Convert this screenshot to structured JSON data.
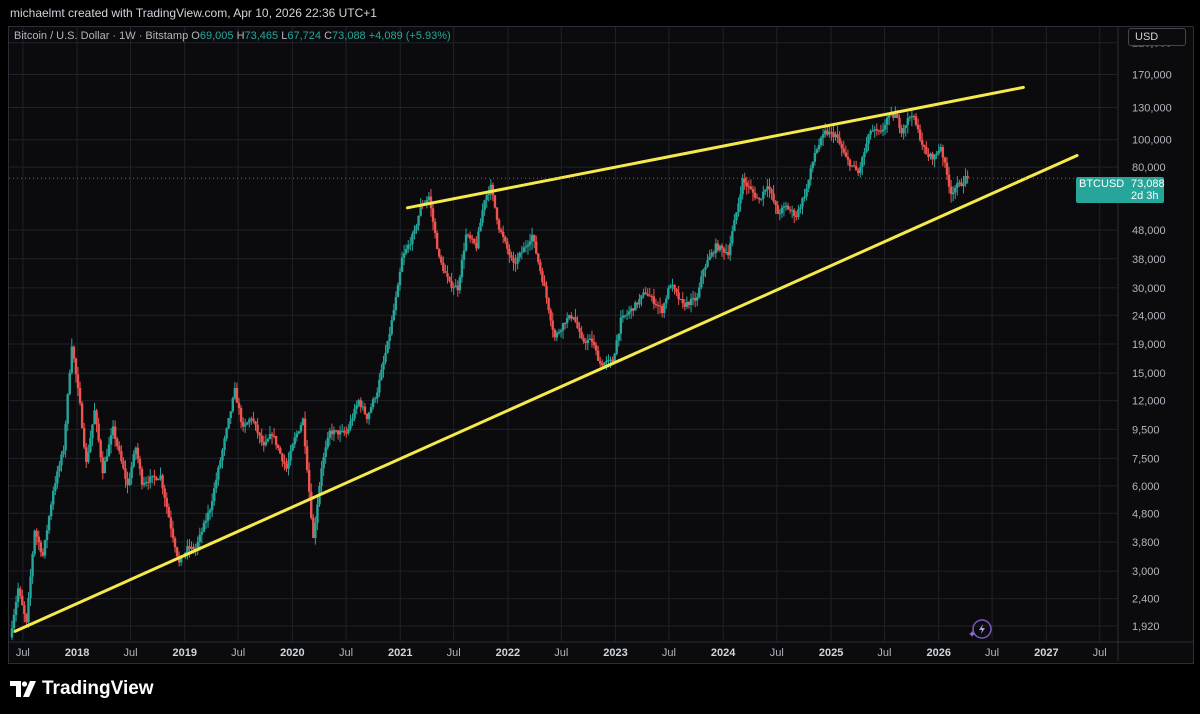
{
  "header": {
    "attribution": "michaelmt created with TradingView.com, Apr 10, 2026 22:36 UTC+1"
  },
  "legend": {
    "instrument": "Bitcoin / U.S. Dollar · 1W · Bitstamp",
    "o_label": "O",
    "o_value": "69,005",
    "h_label": "H",
    "h_value": "73,465",
    "l_label": "L",
    "l_value": "67,724",
    "c_label": "C",
    "c_value": "73,088",
    "change": "+4,089 (+5.93%)"
  },
  "price_scale": {
    "currency": "USD"
  },
  "price_tag": {
    "symbol": "BTCUSD",
    "last_price": "73,088",
    "countdown": "2d 3h"
  },
  "brand": {
    "name": "TradingView"
  },
  "colors": {
    "up": "#26a69a",
    "down": "#ef5350",
    "trendline": "#f5e94c",
    "background": "#0b0b0d",
    "grid": "#1f222a"
  },
  "icons": {
    "logo": "tradingview-logo-icon",
    "assistant": "sparkle-lightning-icon"
  },
  "chart_data": {
    "type": "candlestick",
    "y_scale": "log",
    "ylim": [
      1700,
      250000
    ],
    "xlim": [
      "2017-05-15",
      "2027-09-01"
    ],
    "y_ticks": [
      1920,
      2400,
      3000,
      3800,
      4800,
      6000,
      7500,
      9500,
      12000,
      15000,
      19000,
      24000,
      30000,
      38000,
      48000,
      80000,
      100000,
      130000,
      170000,
      220000
    ],
    "y_tick_labels": [
      "1,920",
      "2,400",
      "3,000",
      "3,800",
      "4,800",
      "6,000",
      "7,500",
      "9,500",
      "12,000",
      "15,000",
      "19,000",
      "24,000",
      "30,000",
      "38,000",
      "48,000",
      "80,000",
      "100,000",
      "130,000",
      "170,000",
      "220,000"
    ],
    "x_ticks": [
      {
        "label": "Jul",
        "date": "2017-07-01",
        "bold": false
      },
      {
        "label": "2018",
        "date": "2018-01-01",
        "bold": true
      },
      {
        "label": "Jul",
        "date": "2018-07-01",
        "bold": false
      },
      {
        "label": "2019",
        "date": "2019-01-01",
        "bold": true
      },
      {
        "label": "Jul",
        "date": "2019-07-01",
        "bold": false
      },
      {
        "label": "2020",
        "date": "2020-01-01",
        "bold": true
      },
      {
        "label": "Jul",
        "date": "2020-07-01",
        "bold": false
      },
      {
        "label": "2021",
        "date": "2021-01-01",
        "bold": true
      },
      {
        "label": "Jul",
        "date": "2021-07-01",
        "bold": false
      },
      {
        "label": "2022",
        "date": "2022-01-01",
        "bold": true
      },
      {
        "label": "Jul",
        "date": "2022-07-01",
        "bold": false
      },
      {
        "label": "2023",
        "date": "2023-01-01",
        "bold": true
      },
      {
        "label": "Jul",
        "date": "2023-07-01",
        "bold": false
      },
      {
        "label": "2024",
        "date": "2024-01-01",
        "bold": true
      },
      {
        "label": "Jul",
        "date": "2024-07-01",
        "bold": false
      },
      {
        "label": "2025",
        "date": "2025-01-01",
        "bold": true
      },
      {
        "label": "Jul",
        "date": "2025-07-01",
        "bold": false
      },
      {
        "label": "2026",
        "date": "2026-01-01",
        "bold": true
      },
      {
        "label": "Jul",
        "date": "2026-07-01",
        "bold": false
      },
      {
        "label": "2027",
        "date": "2027-01-01",
        "bold": true
      },
      {
        "label": "Jul",
        "date": "2027-07-01",
        "bold": false
      }
    ],
    "price_path": [
      [
        "2017-05-22",
        1750
      ],
      [
        "2017-06-19",
        2600
      ],
      [
        "2017-07-17",
        1950
      ],
      [
        "2017-08-14",
        4200
      ],
      [
        "2017-09-11",
        3400
      ],
      [
        "2017-10-16",
        5800
      ],
      [
        "2017-11-20",
        8100
      ],
      [
        "2017-12-18",
        19000
      ],
      [
        "2018-01-15",
        11500
      ],
      [
        "2018-02-05",
        7200
      ],
      [
        "2018-03-05",
        11000
      ],
      [
        "2018-04-02",
        6800
      ],
      [
        "2018-05-07",
        9500
      ],
      [
        "2018-06-25",
        6000
      ],
      [
        "2018-07-23",
        8200
      ],
      [
        "2018-08-13",
        6200
      ],
      [
        "2018-10-15",
        6500
      ],
      [
        "2018-11-19",
        4300
      ],
      [
        "2018-12-17",
        3200
      ],
      [
        "2019-01-14",
        3600
      ],
      [
        "2019-02-11",
        3600
      ],
      [
        "2019-04-01",
        5000
      ],
      [
        "2019-05-13",
        8000
      ],
      [
        "2019-06-24",
        13000
      ],
      [
        "2019-07-22",
        9500
      ],
      [
        "2019-08-19",
        10500
      ],
      [
        "2019-09-30",
        8200
      ],
      [
        "2019-10-28",
        9200
      ],
      [
        "2019-12-16",
        6900
      ],
      [
        "2020-01-13",
        8800
      ],
      [
        "2020-02-10",
        10300
      ],
      [
        "2020-03-16",
        3900
      ],
      [
        "2020-04-13",
        7000
      ],
      [
        "2020-05-11",
        9300
      ],
      [
        "2020-07-06",
        9200
      ],
      [
        "2020-08-17",
        12000
      ],
      [
        "2020-09-14",
        10500
      ],
      [
        "2020-10-19",
        13000
      ],
      [
        "2020-11-23",
        19000
      ],
      [
        "2020-12-28",
        30000
      ],
      [
        "2021-01-11",
        38000
      ],
      [
        "2021-02-22",
        47000
      ],
      [
        "2021-03-15",
        58000
      ],
      [
        "2021-04-12",
        63000
      ],
      [
        "2021-05-17",
        38000
      ],
      [
        "2021-06-21",
        31000
      ],
      [
        "2021-07-19",
        30000
      ],
      [
        "2021-08-16",
        46000
      ],
      [
        "2021-09-20",
        42000
      ],
      [
        "2021-10-18",
        62000
      ],
      [
        "2021-11-08",
        68000
      ],
      [
        "2021-12-06",
        49000
      ],
      [
        "2022-01-24",
        36000
      ],
      [
        "2022-03-28",
        46000
      ],
      [
        "2022-05-09",
        30000
      ],
      [
        "2022-06-13",
        20000
      ],
      [
        "2022-07-18",
        23000
      ],
      [
        "2022-08-15",
        24000
      ],
      [
        "2022-09-12",
        19500
      ],
      [
        "2022-10-17",
        19500
      ],
      [
        "2022-11-14",
        16200
      ],
      [
        "2022-12-26",
        16500
      ],
      [
        "2023-01-23",
        23000
      ],
      [
        "2023-03-13",
        26000
      ],
      [
        "2023-04-17",
        29000
      ],
      [
        "2023-06-12",
        25000
      ],
      [
        "2023-07-10",
        31000
      ],
      [
        "2023-08-21",
        26000
      ],
      [
        "2023-10-09",
        27500
      ],
      [
        "2023-10-30",
        35000
      ],
      [
        "2023-12-11",
        42000
      ],
      [
        "2024-01-22",
        40000
      ],
      [
        "2024-02-26",
        60000
      ],
      [
        "2024-03-11",
        72000
      ],
      [
        "2024-05-06",
        61000
      ],
      [
        "2024-06-03",
        70000
      ],
      [
        "2024-07-08",
        55000
      ],
      [
        "2024-08-05",
        58000
      ],
      [
        "2024-09-09",
        54000
      ],
      [
        "2024-10-14",
        67000
      ],
      [
        "2024-11-11",
        90000
      ],
      [
        "2024-12-16",
        106000
      ],
      [
        "2025-01-20",
        104000
      ],
      [
        "2025-02-24",
        86000
      ],
      [
        "2025-04-07",
        76000
      ],
      [
        "2025-05-19",
        108000
      ],
      [
        "2025-06-23",
        105000
      ],
      [
        "2025-07-14",
        119000
      ],
      [
        "2025-08-11",
        122000
      ],
      [
        "2025-09-01",
        108000
      ],
      [
        "2025-10-06",
        124000
      ],
      [
        "2025-11-03",
        102000
      ],
      [
        "2025-11-24",
        88000
      ],
      [
        "2025-12-22",
        87000
      ],
      [
        "2026-01-12",
        95000
      ],
      [
        "2026-02-02",
        75000
      ],
      [
        "2026-02-16",
        65000
      ],
      [
        "2026-03-02",
        68000
      ],
      [
        "2026-03-23",
        70000
      ],
      [
        "2026-04-06",
        73088
      ]
    ],
    "trendlines": [
      {
        "name": "upper",
        "from": [
          "2021-01-25",
          57500
        ],
        "to": [
          "2026-10-15",
          153000
        ]
      },
      {
        "name": "lower",
        "from": [
          "2017-06-05",
          1840
        ],
        "to": [
          "2027-04-15",
          88000
        ]
      }
    ],
    "last_price": 73088
  }
}
